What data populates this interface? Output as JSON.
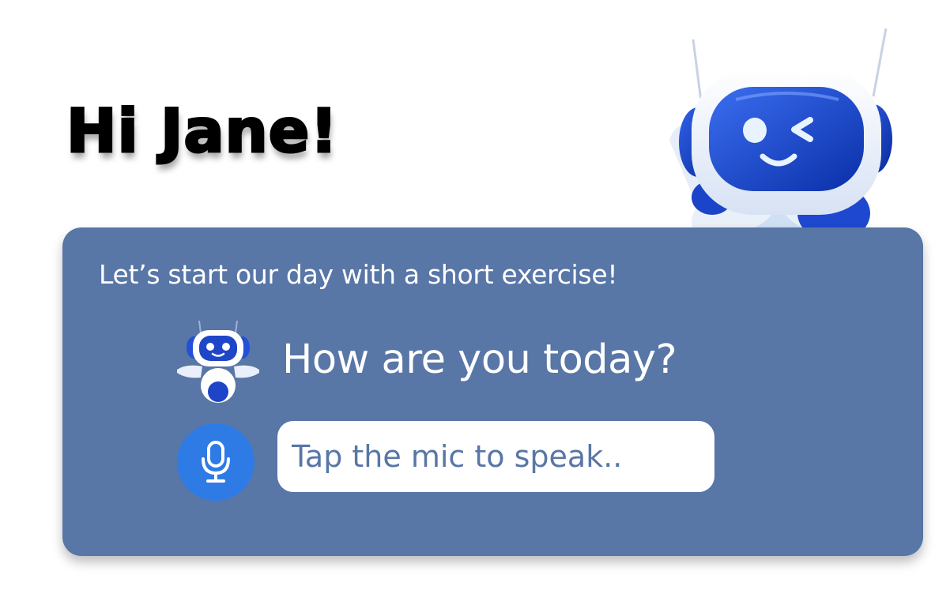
{
  "greeting": "Hi Jane!",
  "card": {
    "intro": "Let’s start our day with a short exercise!",
    "question": "How are you today?",
    "input_placeholder": "Tap the mic to speak.."
  },
  "icons": {
    "mascot": "robot-mascot-icon",
    "assistant": "robot-assistant-icon",
    "mic": "microphone-icon"
  },
  "colors": {
    "card_background": "#5876a6",
    "mic_button": "#2f7be6",
    "text_on_card": "#ffffff",
    "placeholder": "#5876a6"
  }
}
